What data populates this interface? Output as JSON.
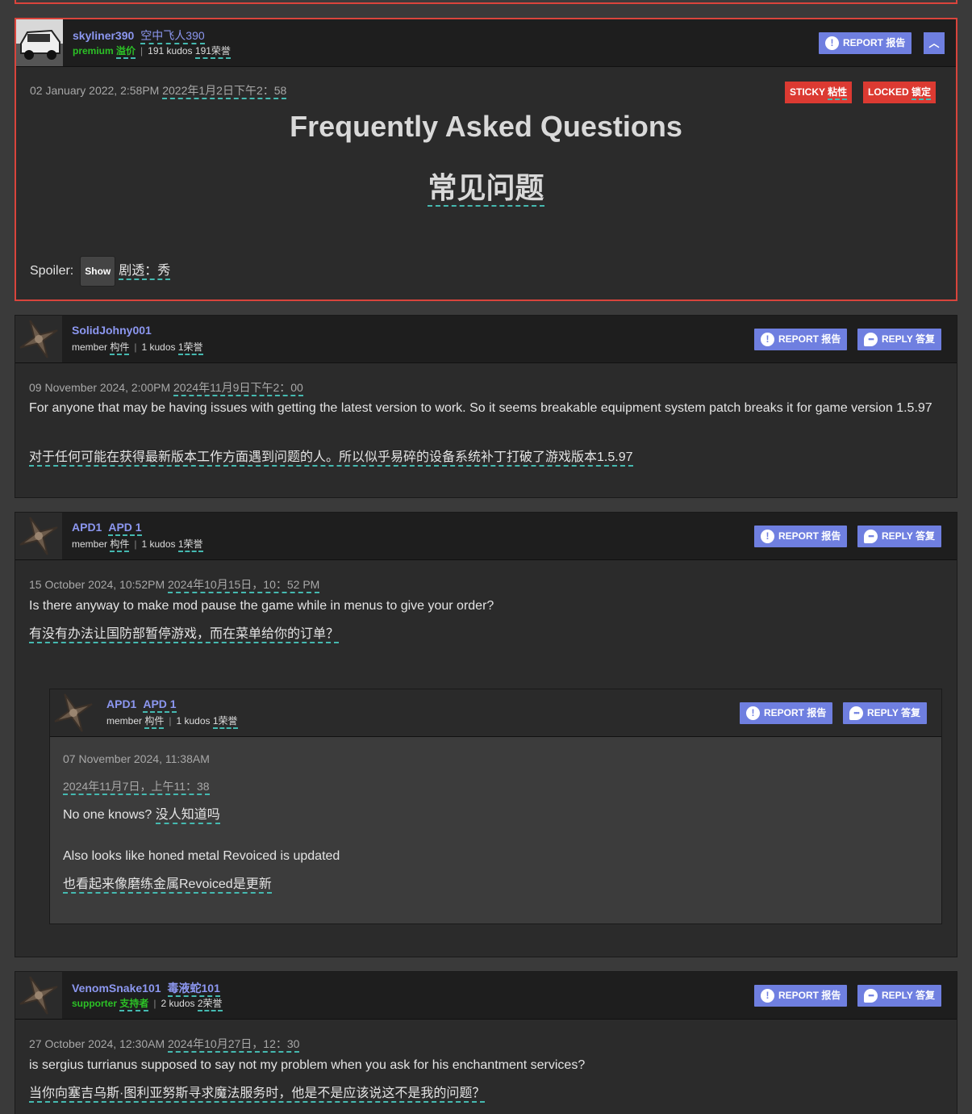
{
  "sticky_post": {
    "username": "skyliner390",
    "username_tr": "空中飞人390",
    "rank": "premium",
    "rank_tr": "溢价",
    "kudos": "191 kudos",
    "kudos_tr": "191荣誉",
    "report_label": "REPORT 报告",
    "collapse_icon": "chevron-up-icon",
    "date": "02 January 2022, 2:58PM",
    "date_tr": "2022年1月2日下午2：58",
    "badge_sticky": "STICKY",
    "badge_sticky_tr": "粘性",
    "badge_locked": "LOCKED",
    "badge_locked_tr": "锁定",
    "title": "Frequently Asked Questions",
    "title_tr": "常见问题",
    "spoiler_label": "Spoiler:",
    "spoiler_button": "Show",
    "spoiler_tr": "剧透：秀"
  },
  "posts": [
    {
      "username": "SolidJohny001",
      "rank": "member",
      "rank_tr": "构件",
      "kudos": "1 kudos",
      "kudos_tr": "1荣誉",
      "report_label": "REPORT 报告",
      "reply_label": "REPLY 答复",
      "date": "09 November 2024, 2:00PM",
      "date_tr": "2024年11月9日下午2：00",
      "text": "For anyone that may be having issues with getting the latest version to work. So it seems breakable equipment system patch breaks it for game version 1.5.97",
      "text_tr": "对于任何可能在获得最新版本工作方面遇到问题的人。所以似乎易碎的设备系统补丁打破了游戏版本1.5.97"
    },
    {
      "username": "APD1",
      "username_tr": "APD 1",
      "rank": "member",
      "rank_tr": "构件",
      "kudos": "1 kudos",
      "kudos_tr": "1荣誉",
      "report_label": "REPORT 报告",
      "reply_label": "REPLY 答复",
      "date": "15 October 2024, 10:52PM",
      "date_tr": "2024年10月15日，10：52 PM",
      "text": "Is there anyway to make mod pause the game while in menus to give your order?",
      "text_tr": "有没有办法让国防部暂停游戏，而在菜单给你的订单？",
      "reply": {
        "username": "APD1",
        "username_tr": "APD 1",
        "rank": "member",
        "rank_tr": "构件",
        "kudos": "1 kudos",
        "kudos_tr": "1荣誉",
        "report_label": "REPORT 报告",
        "reply_label": "REPLY 答复",
        "date": "07 November 2024, 11:38AM",
        "date_tr": "2024年11月7日，上午11：38",
        "text1": "No one knows?",
        "text1_tr": "没人知道吗",
        "text2": "Also looks like honed metal Revoiced is updated",
        "text2_tr": "也看起来像磨练金属Revoiced是更新"
      }
    },
    {
      "username": "VenomSnake101",
      "username_tr": "毒液蛇101",
      "rank": "supporter",
      "rank_tr": "支持者",
      "kudos": "2 kudos",
      "kudos_tr": "2荣誉",
      "report_label": "REPORT 报告",
      "reply_label": "REPLY 答复",
      "date": "27 October 2024, 12:30AM",
      "date_tr": "2024年10月27日，12：30",
      "text": "is sergius turrianus supposed to say not my problem when you ask for his enchantment services?",
      "text_tr": "当你向塞吉乌斯·图利亚努斯寻求魔法服务时，他是不是应该说这不是我的问题？"
    }
  ],
  "icons": {
    "report": "exclamation-icon",
    "reply": "speech-bubble-icon",
    "avatar_default": "default-avatar-icon"
  }
}
